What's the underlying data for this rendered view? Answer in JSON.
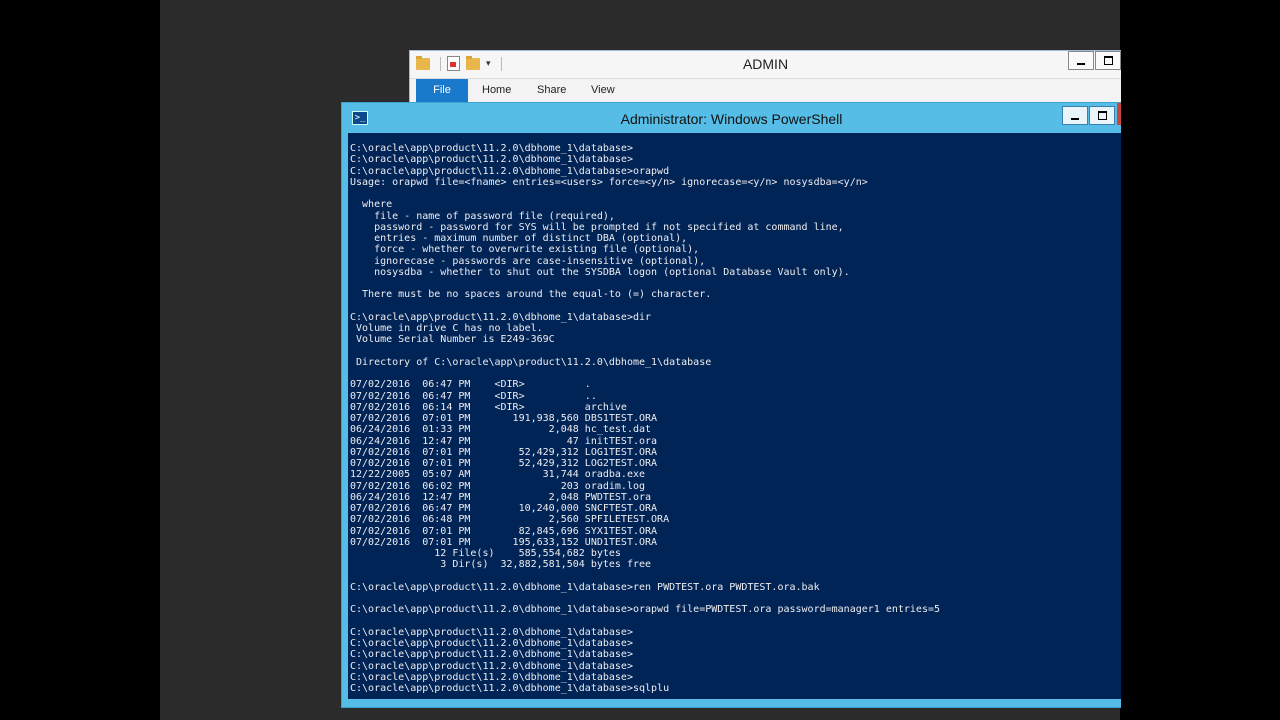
{
  "explorer": {
    "title": "ADMIN",
    "tabs": [
      "File",
      "Home",
      "Share",
      "View"
    ]
  },
  "powershell": {
    "title": "Administrator: Windows PowerShell",
    "lines": [
      "C:\\oracle\\app\\product\\11.2.0\\dbhome_1\\database>",
      "C:\\oracle\\app\\product\\11.2.0\\dbhome_1\\database>",
      "C:\\oracle\\app\\product\\11.2.0\\dbhome_1\\database>orapwd",
      "Usage: orapwd file=<fname> entries=<users> force=<y/n> ignorecase=<y/n> nosysdba=<y/n>",
      "",
      "  where",
      "    file - name of password file (required),",
      "    password - password for SYS will be prompted if not specified at command line,",
      "    entries - maximum number of distinct DBA (optional),",
      "    force - whether to overwrite existing file (optional),",
      "    ignorecase - passwords are case-insensitive (optional),",
      "    nosysdba - whether to shut out the SYSDBA logon (optional Database Vault only).",
      "",
      "  There must be no spaces around the equal-to (=) character.",
      "",
      "C:\\oracle\\app\\product\\11.2.0\\dbhome_1\\database>dir",
      " Volume in drive C has no label.",
      " Volume Serial Number is E249-369C",
      "",
      " Directory of C:\\oracle\\app\\product\\11.2.0\\dbhome_1\\database",
      "",
      "07/02/2016  06:47 PM    <DIR>          .",
      "07/02/2016  06:47 PM    <DIR>          ..",
      "07/02/2016  06:14 PM    <DIR>          archive",
      "07/02/2016  07:01 PM       191,938,560 DBS1TEST.ORA",
      "06/24/2016  01:33 PM             2,048 hc_test.dat",
      "06/24/2016  12:47 PM                47 initTEST.ora",
      "07/02/2016  07:01 PM        52,429,312 LOG1TEST.ORA",
      "07/02/2016  07:01 PM        52,429,312 LOG2TEST.ORA",
      "12/22/2005  05:07 AM            31,744 oradba.exe",
      "07/02/2016  06:02 PM               203 oradim.log",
      "06/24/2016  12:47 PM             2,048 PWDTEST.ora",
      "07/02/2016  06:47 PM        10,240,000 SNCFTEST.ORA",
      "07/02/2016  06:48 PM             2,560 SPFILETEST.ORA",
      "07/02/2016  07:01 PM        82,845,696 SYX1TEST.ORA",
      "07/02/2016  07:01 PM       195,633,152 UND1TEST.ORA",
      "              12 File(s)    585,554,682 bytes",
      "               3 Dir(s)  32,882,581,504 bytes free",
      "",
      "C:\\oracle\\app\\product\\11.2.0\\dbhome_1\\database>ren PWDTEST.ora PWDTEST.ora.bak",
      "",
      "C:\\oracle\\app\\product\\11.2.0\\dbhome_1\\database>orapwd file=PWDTEST.ora password=manager1 entries=5",
      "",
      "C:\\oracle\\app\\product\\11.2.0\\dbhome_1\\database>",
      "C:\\oracle\\app\\product\\11.2.0\\dbhome_1\\database>",
      "C:\\oracle\\app\\product\\11.2.0\\dbhome_1\\database>",
      "C:\\oracle\\app\\product\\11.2.0\\dbhome_1\\database>",
      "C:\\oracle\\app\\product\\11.2.0\\dbhome_1\\database>",
      "C:\\oracle\\app\\product\\11.2.0\\dbhome_1\\database>sqlplu"
    ]
  }
}
